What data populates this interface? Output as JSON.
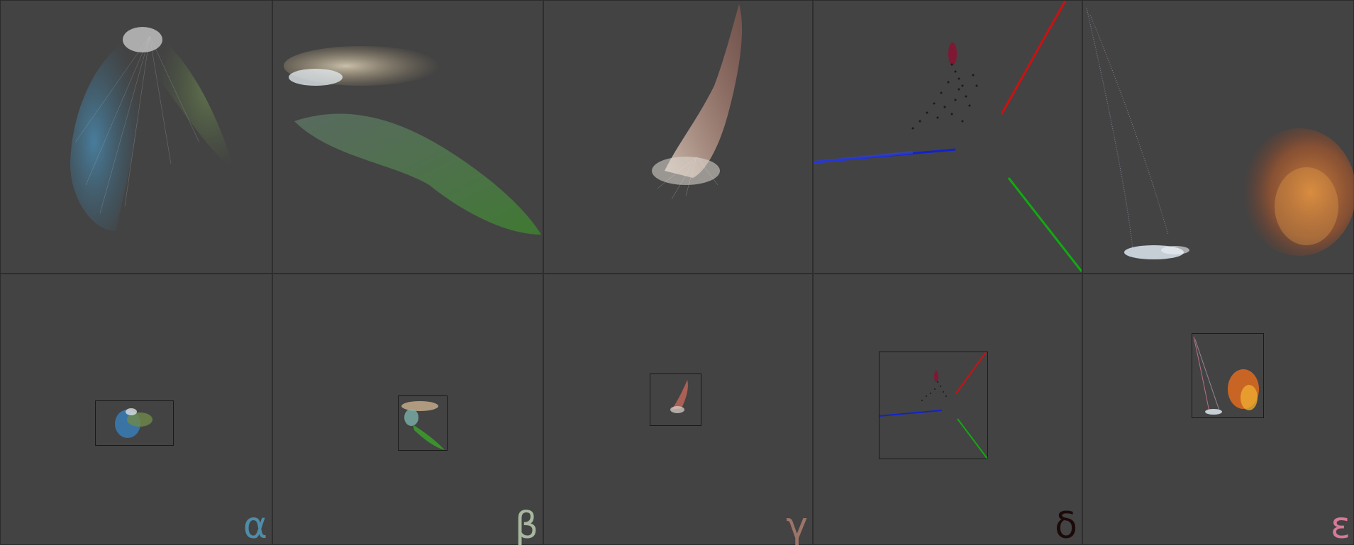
{
  "views": [
    {
      "id": "alpha",
      "label": "α",
      "label_color": "#4f8da8"
    },
    {
      "id": "beta",
      "label": "β",
      "label_color": "#a8b8a0"
    },
    {
      "id": "gamma",
      "label": "γ",
      "label_color": "#9c7468"
    },
    {
      "id": "delta",
      "label": "δ",
      "label_color": "#1c0a0a"
    },
    {
      "id": "epsilon",
      "label": "ε",
      "label_color": "#d77a98"
    }
  ],
  "colors": {
    "background": "#434343",
    "grid_line": "#2e2e2e",
    "frame_border": "#1a1a1a",
    "axis_red": "#cc1111",
    "axis_green": "#11aa11",
    "axis_blue": "#1122cc"
  }
}
